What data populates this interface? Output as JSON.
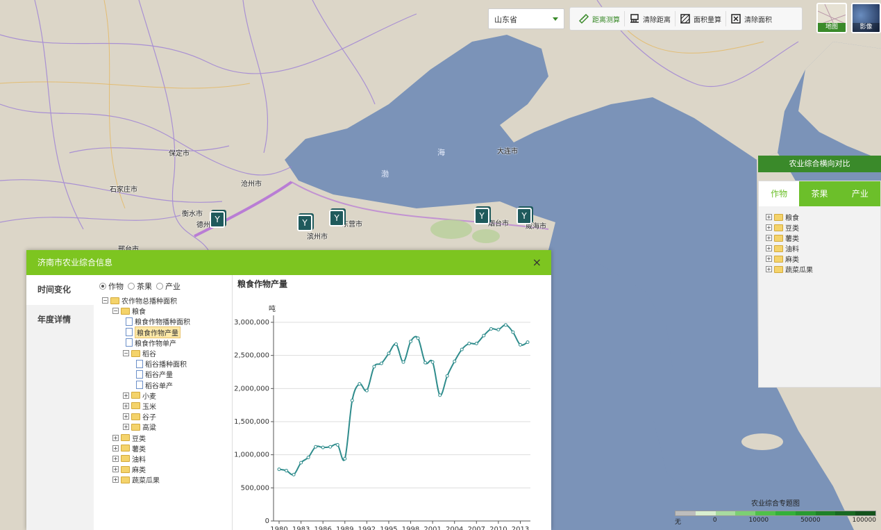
{
  "map": {
    "labels": [
      {
        "text": "保定市",
        "kind": "city"
      },
      {
        "text": "石家庄市",
        "kind": "city"
      },
      {
        "text": "沧州市",
        "kind": "city"
      },
      {
        "text": "衡水市",
        "kind": "city"
      },
      {
        "text": "德州",
        "kind": "city"
      },
      {
        "text": "滨州市",
        "kind": "city"
      },
      {
        "text": "东营市",
        "kind": "city"
      },
      {
        "text": "邢台市",
        "kind": "city"
      },
      {
        "text": "烟台市",
        "kind": "city"
      },
      {
        "text": "威海市",
        "kind": "city"
      },
      {
        "text": "大连市",
        "kind": "city"
      },
      {
        "text": "海",
        "kind": "sea"
      },
      {
        "text": "渤",
        "kind": "sea"
      }
    ],
    "marker_icon": "sprout-icon"
  },
  "toolbar": {
    "province": "山东省",
    "tools": [
      {
        "label": "距离测算",
        "icon": "ruler-icon",
        "active": true
      },
      {
        "label": "清除距离",
        "icon": "eraser-icon",
        "active": false
      },
      {
        "label": "面积量算",
        "icon": "area-icon",
        "active": false
      },
      {
        "label": "清除面积",
        "icon": "clear-area-icon",
        "active": false
      }
    ],
    "basemaps": [
      {
        "label": "地图"
      },
      {
        "label": "影像"
      }
    ]
  },
  "right_panel": {
    "header": "农业综合横向对比",
    "tabs": [
      {
        "label": "作物",
        "active": true
      },
      {
        "label": "茶果",
        "active": false
      },
      {
        "label": "产业",
        "active": false
      }
    ],
    "tree": [
      {
        "label": "粮食"
      },
      {
        "label": "豆类"
      },
      {
        "label": "薯类"
      },
      {
        "label": "油料"
      },
      {
        "label": "麻类"
      },
      {
        "label": "蔬菜瓜果"
      }
    ]
  },
  "legend": {
    "title": "农业综合专题图",
    "labels": [
      "无",
      "0",
      "10000",
      "50000",
      "100000"
    ],
    "colors": [
      "#bdbdbd",
      "#d9efd0",
      "#a8dba0",
      "#7ccf74",
      "#4fc04a",
      "#33b03a",
      "#289a31",
      "#1e8128",
      "#186a22",
      "#12521b"
    ]
  },
  "dialog": {
    "title": "济南市农业综合信息",
    "close": "×",
    "left_tabs": [
      {
        "label": "时间变化",
        "active": true
      },
      {
        "label": "年度详情",
        "active": false
      }
    ],
    "radios": [
      {
        "label": "作物",
        "checked": true
      },
      {
        "label": "茶果",
        "checked": false
      },
      {
        "label": "产业",
        "checked": false
      }
    ],
    "tree": [
      {
        "label": "农作物总播种面积",
        "level": 0,
        "type": "folder",
        "toggle": "⊟"
      },
      {
        "label": "粮食",
        "level": 1,
        "type": "folder",
        "toggle": "⊟"
      },
      {
        "label": "粮食作物播种面积",
        "level": 2,
        "type": "file"
      },
      {
        "label": "粮食作物产量",
        "level": 2,
        "type": "file",
        "selected": true
      },
      {
        "label": "粮食作物单产",
        "level": 2,
        "type": "file"
      },
      {
        "label": "稻谷",
        "level": 2,
        "type": "folder",
        "toggle": "⊟"
      },
      {
        "label": "稻谷播种面积",
        "level": 3,
        "type": "file"
      },
      {
        "label": "稻谷产量",
        "level": 3,
        "type": "file"
      },
      {
        "label": "稻谷单产",
        "level": 3,
        "type": "file"
      },
      {
        "label": "小麦",
        "level": 2,
        "type": "folder",
        "toggle": "⊞"
      },
      {
        "label": "玉米",
        "level": 2,
        "type": "folder",
        "toggle": "⊞"
      },
      {
        "label": "谷子",
        "level": 2,
        "type": "folder",
        "toggle": "⊞"
      },
      {
        "label": "高粱",
        "level": 2,
        "type": "folder",
        "toggle": "⊞"
      },
      {
        "label": "豆类",
        "level": 1,
        "type": "folder",
        "toggle": "⊞"
      },
      {
        "label": "薯类",
        "level": 1,
        "type": "folder",
        "toggle": "⊞"
      },
      {
        "label": "油料",
        "level": 1,
        "type": "folder",
        "toggle": "⊞"
      },
      {
        "label": "麻类",
        "level": 1,
        "type": "folder",
        "toggle": "⊞"
      },
      {
        "label": "蔬菜瓜果",
        "level": 1,
        "type": "folder",
        "toggle": "⊞"
      }
    ]
  },
  "chart_data": {
    "type": "line",
    "title": "粮食作物产量",
    "ylabel": "吨",
    "xlabel": "",
    "ylim": [
      0,
      3000000
    ],
    "yticks": [
      0,
      500000,
      1000000,
      1500000,
      2000000,
      2500000,
      3000000
    ],
    "ytick_labels": [
      "0",
      "500,000",
      "1,000,000",
      "1,500,000",
      "2,000,000",
      "2,500,000",
      "3,000,000"
    ],
    "xtick_labels": [
      "1980",
      "1983",
      "1986",
      "1989",
      "1992",
      "1995",
      "1998",
      "2001",
      "2004",
      "2007",
      "2010",
      "2013"
    ],
    "x": [
      1980,
      1981,
      1982,
      1983,
      1984,
      1985,
      1986,
      1987,
      1988,
      1989,
      1990,
      1991,
      1992,
      1993,
      1994,
      1995,
      1996,
      1997,
      1998,
      1999,
      2000,
      2001,
      2002,
      2003,
      2004,
      2005,
      2006,
      2007,
      2008,
      2009,
      2010,
      2011,
      2012,
      2013,
      2014
    ],
    "series": [
      {
        "color": "#2f8c8c",
        "values": [
          780000,
          760000,
          700000,
          880000,
          960000,
          1120000,
          1110000,
          1120000,
          1150000,
          940000,
          1820000,
          2070000,
          1970000,
          2330000,
          2380000,
          2530000,
          2670000,
          2400000,
          2710000,
          2760000,
          2390000,
          2400000,
          1900000,
          2190000,
          2410000,
          2590000,
          2680000,
          2680000,
          2800000,
          2900000,
          2890000,
          2960000,
          2850000,
          2660000,
          2700000
        ]
      }
    ],
    "grid": true,
    "legend": "none"
  }
}
